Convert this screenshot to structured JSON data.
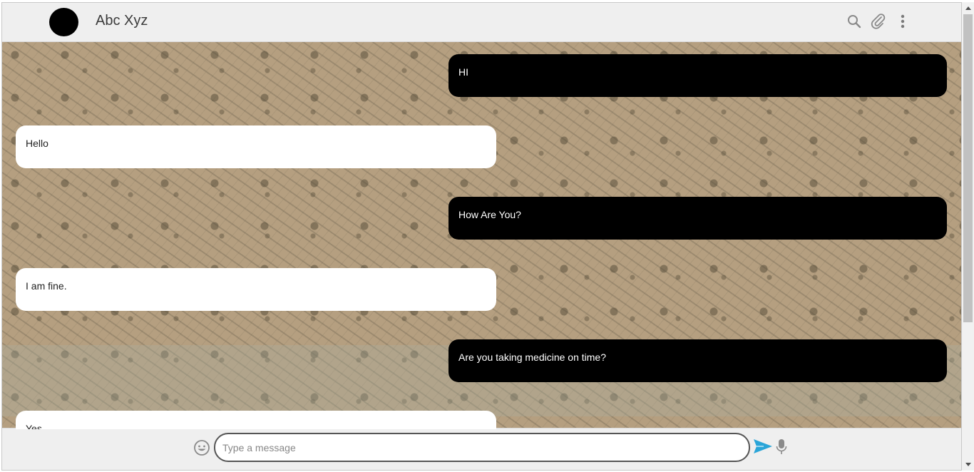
{
  "header": {
    "contact_name": "Abc Xyz",
    "icons": [
      "search-icon",
      "paperclip-icon",
      "more-vertical-icon"
    ]
  },
  "messages": [
    {
      "direction": "outgoing",
      "text": "HI"
    },
    {
      "direction": "incoming",
      "text": "Hello"
    },
    {
      "direction": "outgoing",
      "text": "How Are You?"
    },
    {
      "direction": "incoming",
      "text": "I am fine."
    },
    {
      "direction": "outgoing",
      "text": "Are you taking medicine on time?"
    },
    {
      "direction": "incoming",
      "text": "Yes"
    }
  ],
  "composer": {
    "placeholder": "Type a message",
    "value": ""
  },
  "colors": {
    "outgoing_bubble": "#000000",
    "incoming_bubble": "#ffffff",
    "send_icon": "#2aa5d8",
    "header_bg": "#efefef"
  }
}
